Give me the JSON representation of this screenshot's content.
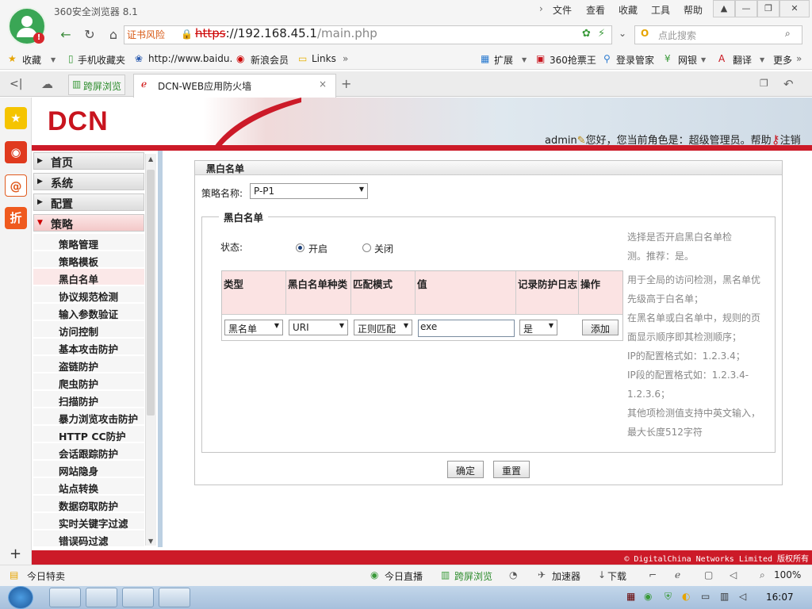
{
  "browser": {
    "title": "360安全浏览器 8.1",
    "menu": [
      "文件",
      "查看",
      "收藏",
      "工具",
      "帮助"
    ],
    "cert_warning": "证书风险",
    "url_scheme": "https",
    "url_host": "://192.168.45.1",
    "url_path": "/main.php",
    "search_placeholder": "点此搜索",
    "bookmarks": [
      "收藏",
      "手机收藏夹",
      "http://www.baidu.",
      "新浪会员",
      "Links",
      "扩展",
      "360抢票王",
      "登录管家",
      "网银",
      "翻译",
      "更多"
    ],
    "tabs": [
      {
        "label": "跨屏浏览"
      },
      {
        "label": "DCN-WEB应用防火墙"
      }
    ]
  },
  "app": {
    "logo": "DCN",
    "admin_name": "admin",
    "greeting": "您好，您当前角色是：超级管理员。",
    "help": "帮助",
    "logout": "注销",
    "menu_top": [
      "首页",
      "系统",
      "配置",
      "策略"
    ],
    "menu_sub": [
      "策略管理",
      "策略模板",
      "黑白名单",
      "协议规范检测",
      "输入参数验证",
      "访问控制",
      "基本攻击防护",
      "盗链防护",
      "爬虫防护",
      "扫描防护",
      "暴力浏览攻击防护",
      "HTTP CC防护",
      "会话跟踪防护",
      "网站隐身",
      "站点转换",
      "数据窃取防护",
      "实时关键字过滤",
      "错误码过滤"
    ],
    "copyright": "© DigitalChina Networks Limited 版权所有"
  },
  "content": {
    "panel_title": "黑白名单",
    "policy_label": "策略名称:",
    "policy_value": "P-P1",
    "fieldset_title": "黑白名单",
    "status_label": "状态:",
    "status_on": "开启",
    "status_off": "关闭",
    "status_selected": "开启",
    "table_headers": [
      "类型",
      "黑白名单种类",
      "匹配模式",
      "值",
      "记录防护日志",
      "操作"
    ],
    "row": {
      "type": "黑名单",
      "kind": "URI",
      "match": "正则匹配",
      "value": "exe",
      "log": "是",
      "action": "添加"
    },
    "help_lines": [
      "选择是否开启黑白名单检",
      "测。推荐：是。",
      "用于全局的访问检测，黑名单优",
      "先级高于白名单；",
      "在黑名单或白名单中，规则的页",
      "面显示顺序即其检测顺序；",
      "IP的配置格式如：1.2.3.4；",
      "IP段的配置格式如：1.2.3.4-",
      "1.2.3.6；",
      "其他项检测值支持中英文输入，",
      "最大长度512字符"
    ],
    "ok_button": "确定",
    "reset_button": "重置"
  },
  "statusbar": {
    "left": "今日特卖",
    "items": [
      "今日直播",
      "跨屏浏览",
      "加速器",
      "下载"
    ],
    "zoom": "100%"
  },
  "taskbar": {
    "clock": "16:07"
  },
  "colors": {
    "brand_red": "#cc1a28",
    "accent_green": "#3aa655",
    "header_pink": "#fbe3e3"
  }
}
